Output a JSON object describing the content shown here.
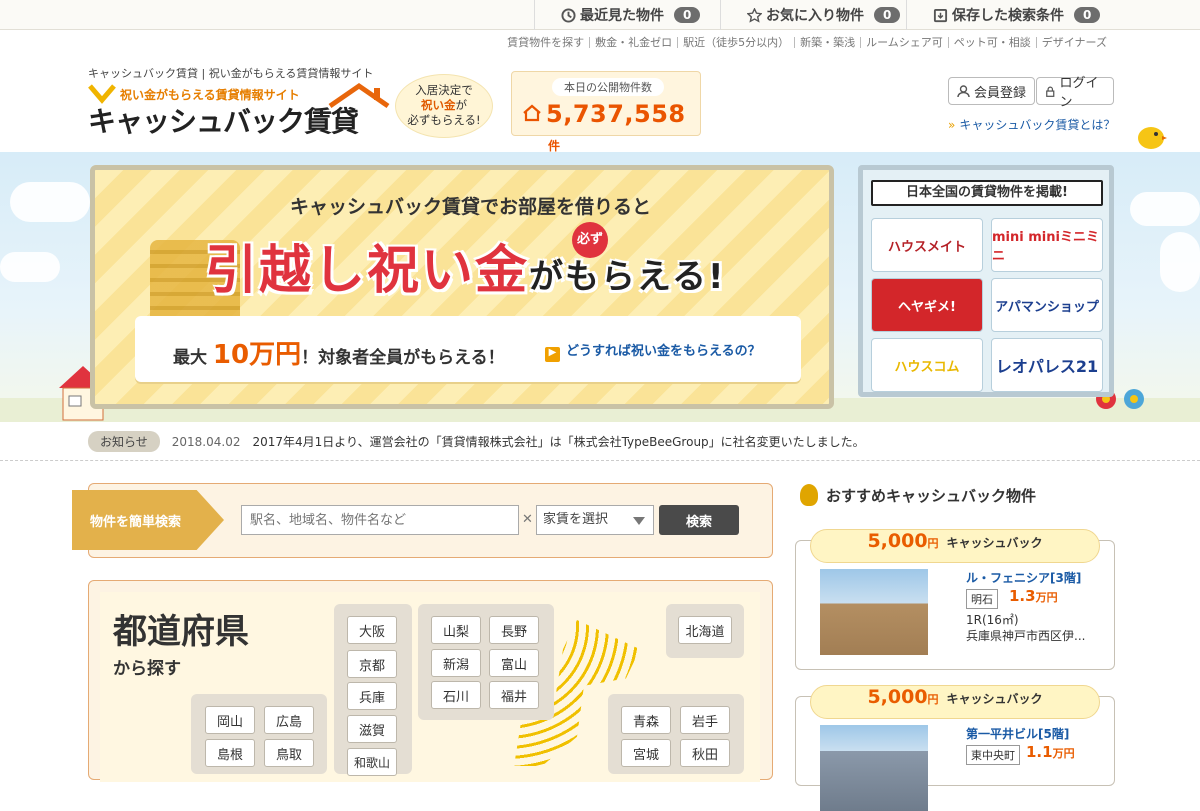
{
  "topbar": {
    "recent_label": "最近見た物件",
    "recent_count": "0",
    "favorites_label": "お気に入り物件",
    "favorites_count": "0",
    "saved_label": "保存した検索条件",
    "saved_count": "0"
  },
  "subnav": [
    "賃貸物件を探す",
    "敷金・礼金ゼロ",
    "駅近（徒歩5分以内）",
    "新築・築浅",
    "ルームシェア可",
    "ペット可・相談",
    "デザイナーズ"
  ],
  "header": {
    "tagline": "キャッシュバック賃貸 | 祝い金がもらえる賃貸情報サイト",
    "logo_sub": "祝い金がもらえる賃貸情報サイト",
    "logo_main": "キャッシュバック賃貸",
    "bubble_line1": "入居決定で",
    "bubble_line2": "祝い金",
    "bubble_line2b": "が",
    "bubble_line3": "必ずもらえる!",
    "count_label": "本日の公開物件数",
    "count_value": "5,737,558",
    "count_unit": "件",
    "register_label": "会員登録",
    "login_label": "ログイン",
    "about_label": "キャッシュバック賃貸とは？"
  },
  "banner": {
    "line1": "キャッシュバック賃貸でお部屋を借りると",
    "line2_big": "引越し祝い金",
    "line2_small": "がもらえる!",
    "must": "必ず",
    "max_pre": "最大",
    "max_amount": "10万円",
    "max_post": "！対象者全員がもらえる！",
    "how_link": "どうすれば祝い金をもらえるの？"
  },
  "partners": {
    "title": "日本全国の賃貸物件を掲載!",
    "logos": [
      "ハウスメイト",
      "mini miniミニミニ",
      "ヘヤギメ!",
      "アパマンショップ",
      "ハウスコム",
      "レオパレス21"
    ]
  },
  "notice": {
    "tag": "お知らせ",
    "date": "2018.04.02",
    "text": "2017年4月1日より、運営会社の「賃貸情報株式会社」は「株式会社TypeBeeGroup」に社名変更いたしました。"
  },
  "search": {
    "flag": "物件を簡単検索",
    "placeholder": "駅名、地域名、物件名など",
    "rent_select": "家賃を選択",
    "button": "検索"
  },
  "prefecture": {
    "title": "都道府県",
    "subtitle": "から探す",
    "kinki": [
      "大阪",
      "京都",
      "兵庫",
      "滋賀",
      "和歌山"
    ],
    "chubu": [
      "山梨",
      "長野",
      "新潟",
      "富山",
      "石川",
      "福井"
    ],
    "chugoku": [
      "岡山",
      "広島",
      "島根",
      "鳥取"
    ],
    "hokkaido": [
      "北海道"
    ],
    "tohoku": [
      "青森",
      "岩手",
      "宮城",
      "秋田"
    ]
  },
  "recommend": {
    "title": "おすすめキャッシュバック物件",
    "cards": [
      {
        "amount": "5,000",
        "yen": "円",
        "cb_label": "キャッシュバック",
        "name": "ル・フェニシア[3階]",
        "station": "明石",
        "price": "1.3",
        "price_unit": "万円",
        "layout": "1R(16㎡)",
        "address": "兵庫県神戸市西区伊..."
      },
      {
        "amount": "5,000",
        "yen": "円",
        "cb_label": "キャッシュバック",
        "name": "第一平井ビル[5階]",
        "station": "東中央町",
        "price": "1.1",
        "price_unit": "万円"
      }
    ]
  },
  "colors": {
    "accent": "#e95c00",
    "red": "#e0333e",
    "link": "#1a5aa5",
    "gold": "#e3b14b"
  }
}
